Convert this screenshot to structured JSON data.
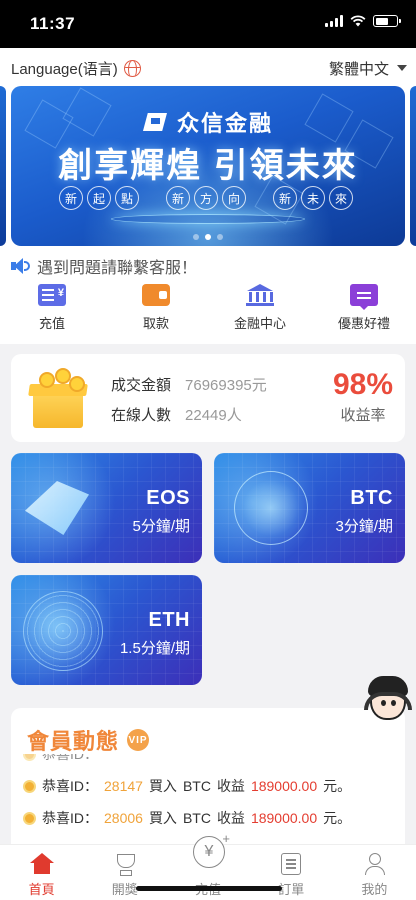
{
  "status_bar": {
    "time": "11:37"
  },
  "language": {
    "label": "Language(语言)",
    "current": "繁體中文"
  },
  "banner": {
    "brand": "众信金融",
    "slogan": "創享輝煌 引領未來",
    "chips_group1": [
      "新",
      "起",
      "點"
    ],
    "chips_group2": [
      "新",
      "方",
      "向"
    ],
    "chips_group3": [
      "新",
      "未",
      "來"
    ],
    "slides_total": 3,
    "active_slide": 2
  },
  "notice": {
    "text": "遇到問題請聯繫客服！"
  },
  "quick_menu": [
    {
      "label": "充值",
      "icon": "recharge-icon",
      "color": "#5d6ce6"
    },
    {
      "label": "取款",
      "icon": "wallet-icon",
      "color": "#f08a2c"
    },
    {
      "label": "金融中心",
      "icon": "bank-icon",
      "color": "#5869e0"
    },
    {
      "label": "優惠好禮",
      "icon": "gift-icon",
      "color": "#8b3fd8"
    }
  ],
  "stats": {
    "volume_label": "成交金額",
    "volume_value": "76969395元",
    "online_label": "在線人數",
    "online_value": "22449人",
    "rate_value": "98%",
    "rate_label": "收益率"
  },
  "products": [
    {
      "name": "EOS",
      "period": "5分鐘/期"
    },
    {
      "name": "BTC",
      "period": "3分鐘/期"
    },
    {
      "name": "ETH",
      "period": "1.5分鐘/期"
    }
  ],
  "members": {
    "title": "會員動態",
    "badge": "VIP",
    "feed": [
      {
        "prefix": "恭喜ID：",
        "uid": "28147",
        "action": "買入",
        "coin": "BTC",
        "gain_label": "收益",
        "amount": "189000.00",
        "suffix": "元。"
      },
      {
        "prefix": "恭喜ID：",
        "uid": "28006",
        "action": "買入",
        "coin": "BTC",
        "gain_label": "收益",
        "amount": "189000.00",
        "suffix": "元。"
      }
    ]
  },
  "tabbar": [
    {
      "label": "首頁",
      "icon": "home-icon",
      "active": true
    },
    {
      "label": "開獎",
      "icon": "trophy-icon",
      "active": false
    },
    {
      "label": "充值",
      "icon": "yuan-icon",
      "active": false
    },
    {
      "label": "訂單",
      "icon": "order-icon",
      "active": false
    },
    {
      "label": "我的",
      "icon": "user-icon",
      "active": false
    }
  ],
  "colors": {
    "accent": "#e03a2e",
    "rate": "#ea4c3c",
    "members_title": "#f0873a",
    "uid": "#f0a33a",
    "amount": "#e43d30"
  }
}
